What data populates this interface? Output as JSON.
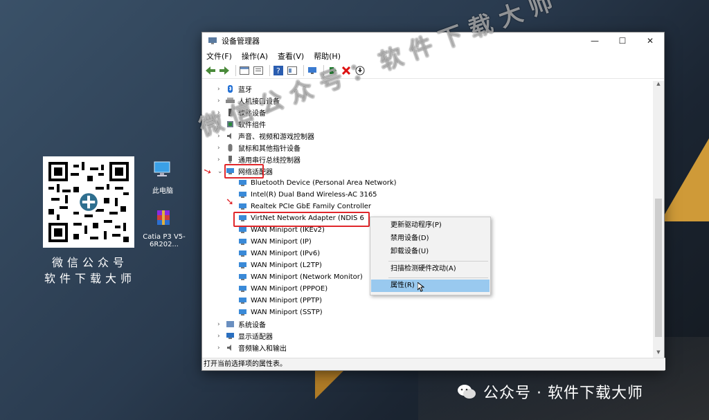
{
  "window": {
    "title": "设备管理器",
    "menu": [
      "文件(F)",
      "操作(A)",
      "查看(V)",
      "帮助(H)"
    ],
    "controls": {
      "min": "—",
      "max": "☐",
      "close": "✕"
    }
  },
  "tree": {
    "categories_top": [
      {
        "label": "蓝牙",
        "icon": "bluetooth-icon"
      },
      {
        "label": "人机接口设备",
        "icon": "hid-icon"
      },
      {
        "label": "软件设备",
        "icon": "software-device-icon"
      },
      {
        "label": "软件组件",
        "icon": "software-component-icon"
      },
      {
        "label": "声音、视频和游戏控制器",
        "icon": "sound-icon"
      },
      {
        "label": "鼠标和其他指针设备",
        "icon": "mouse-icon"
      },
      {
        "label": "通用串行总线控制器",
        "icon": "usb-icon"
      }
    ],
    "expanded_category": {
      "label": "网络适配器",
      "icon": "network-adapter-icon"
    },
    "network_adapters": [
      "Bluetooth Device (Personal Area Network)",
      "Intel(R) Dual Band Wireless-AC 3165",
      "Realtek PCIe GbE Family Controller",
      "VirtNet Network Adapter (NDIS 6",
      "WAN Miniport (IKEv2)",
      "WAN Miniport (IP)",
      "WAN Miniport (IPv6)",
      "WAN Miniport (L2TP)",
      "WAN Miniport (Network Monitor)",
      "WAN Miniport (PPPOE)",
      "WAN Miniport (PPTP)",
      "WAN Miniport (SSTP)"
    ],
    "categories_bottom": [
      {
        "label": "系统设备",
        "icon": "system-device-icon"
      },
      {
        "label": "显示适配器",
        "icon": "display-adapter-icon"
      },
      {
        "label": "音频输入和输出",
        "icon": "audio-io-icon"
      }
    ]
  },
  "context_menu": {
    "items": [
      "更新驱动程序(P)",
      "禁用设备(D)",
      "卸载设备(U)",
      "扫描检测硬件改动(A)",
      "属性(R)"
    ],
    "highlighted": "属性(R)"
  },
  "status_text": "打开当前选择项的属性表。",
  "desktop": {
    "icons": [
      {
        "label": "此电脑",
        "icon": "computer-icon"
      },
      {
        "label": "Catia P3 V5-6R202...",
        "icon": "winrar-icon"
      }
    ],
    "qr_caption_line1": "微信公众号",
    "qr_caption_line2": "软件下载大师"
  },
  "watermark_text": "微信公众号：软件下载大师",
  "footer_text": "公众号 · 软件下载大师",
  "colors": {
    "highlight": "#e0262a",
    "menu_highlight": "#99c9ef",
    "accent_gold": "#e3a73a"
  }
}
